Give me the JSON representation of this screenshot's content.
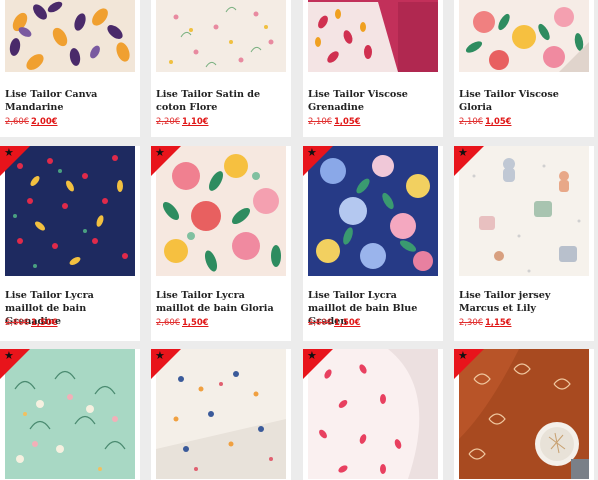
{
  "products": [
    {
      "title": "Lise Tailor Canva Mandarine",
      "old_price": "2,60€",
      "new_price": "2,00€",
      "badge": "",
      "icon": "fabric-canva-mandarine-image"
    },
    {
      "title": "Lise Tailor Satin de coton Flore",
      "old_price": "2,20€",
      "new_price": "1,10€",
      "badge": "",
      "icon": "fabric-satin-flore-image"
    },
    {
      "title": "Lise Tailor Viscose Grenadine",
      "old_price": "2,10€",
      "new_price": "1,05€",
      "badge": "",
      "icon": "fabric-viscose-grenadine-image"
    },
    {
      "title": "Lise Tailor Viscose Gloria",
      "old_price": "2,10€",
      "new_price": "1,05€",
      "badge": "",
      "icon": "fabric-viscose-gloria-image"
    },
    {
      "title": "Lise Tailor Lycra maillot de bain Grenadine",
      "old_price": "2,60€",
      "new_price": "1,50€",
      "badge": "★",
      "icon": "fabric-lycra-grenadine-image"
    },
    {
      "title": "Lise Tailor Lycra maillot de bain Gloria",
      "old_price": "2,60€",
      "new_price": "1,50€",
      "badge": "★",
      "icon": "fabric-lycra-gloria-image"
    },
    {
      "title": "Lise Tailor Lycra maillot de bain Blue Graden",
      "old_price": "2,60€",
      "new_price": "1,50€",
      "badge": "★",
      "icon": "fabric-lycra-blue-graden-image"
    },
    {
      "title": "Lise Tailor jersey Marcus et Lily",
      "old_price": "2,30€",
      "new_price": "1,15€",
      "badge": "★",
      "icon": "fabric-jersey-marcus-lily-image"
    },
    {
      "title": "",
      "old_price": "",
      "new_price": "",
      "badge": "★",
      "icon": "fabric-mint-floral-image"
    },
    {
      "title": "",
      "old_price": "",
      "new_price": "",
      "badge": "★",
      "icon": "fabric-white-flowers-image"
    },
    {
      "title": "",
      "old_price": "",
      "new_price": "",
      "badge": "★",
      "icon": "fabric-pink-leaves-image"
    },
    {
      "title": "",
      "old_price": "",
      "new_price": "",
      "badge": "★",
      "icon": "fabric-rust-floral-image"
    }
  ],
  "colors": {
    "badge": "#e8141b",
    "sale_price": "#e01818"
  }
}
